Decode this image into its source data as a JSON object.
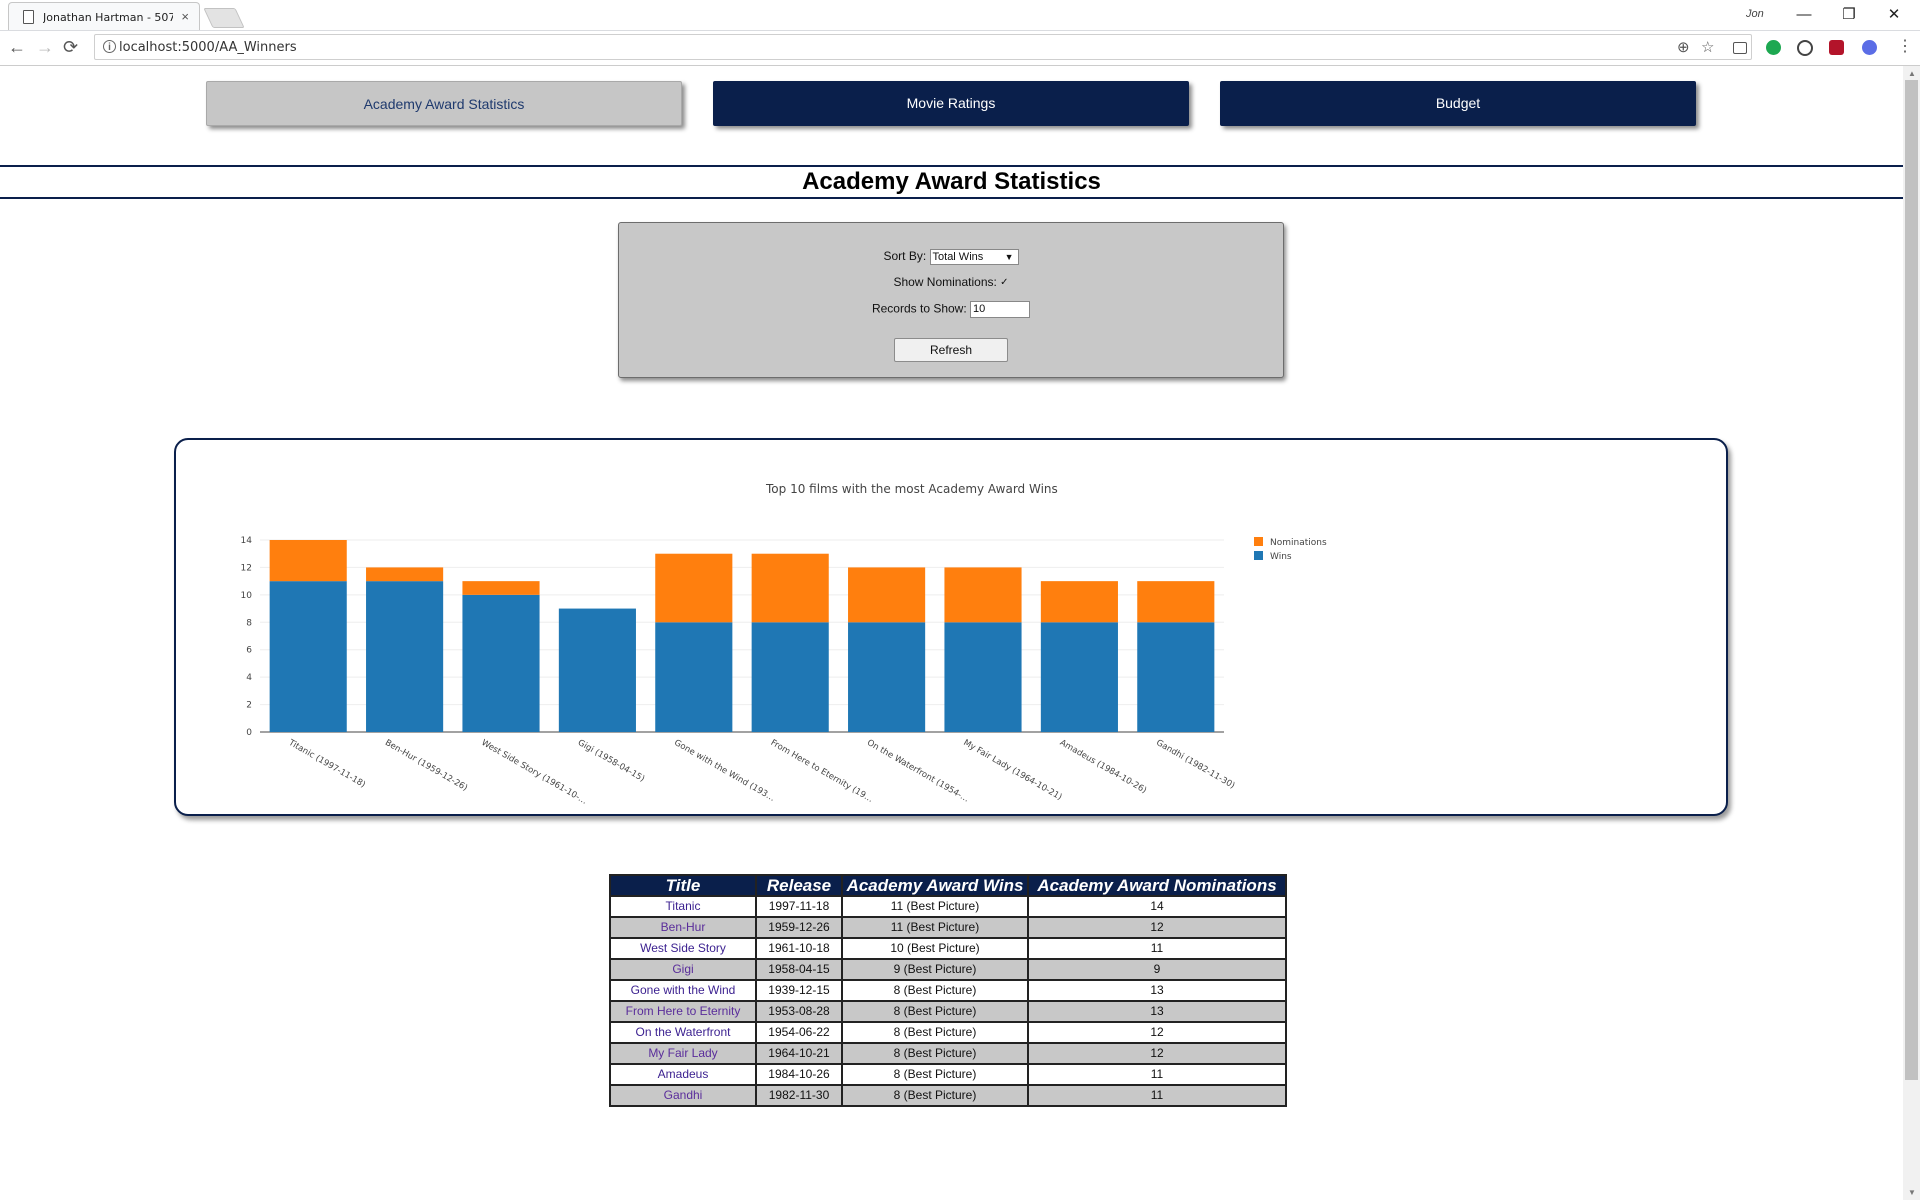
{
  "browser": {
    "tab_title": "Jonathan Hartman - 507",
    "tab_close": "×",
    "profile": "Jon",
    "url": "localhost:5000/AA_Winners",
    "back": "←",
    "forward": "→",
    "reload": "⟳",
    "minimize": "—",
    "restore": "❐",
    "close": "✕",
    "zoom": "⊕",
    "bookmark": "☆",
    "menu": "⋮"
  },
  "nav": {
    "items": [
      {
        "label": "Academy Award Statistics",
        "active": true
      },
      {
        "label": "Movie Ratings",
        "active": false
      },
      {
        "label": "Budget",
        "active": false
      }
    ]
  },
  "page": {
    "title": "Academy Award Statistics"
  },
  "controls": {
    "sort_label": "Sort By:",
    "sort_value": "Total Wins",
    "nominations_label": "Show Nominations:",
    "nominations_checked": "✓",
    "records_label": "Records to Show:",
    "records_value": "10",
    "refresh_label": "Refresh"
  },
  "chart_data": {
    "type": "bar",
    "stacked": true,
    "title": "Top 10 films with the most Academy Award Wins",
    "categories": [
      "Titanic (1997-11-18)",
      "Ben-Hur (1959-12-26)",
      "West Side Story (1961-10-18)",
      "Gigi (1958-04-15)",
      "Gone with the Wind (1939-12-15)",
      "From Here to Eternity (1953-08-28)",
      "On the Waterfront (1954-06-22)",
      "My Fair Lady (1964-10-21)",
      "Amadeus (1984-10-26)",
      "Gandhi (1982-11-30)"
    ],
    "categories_display": [
      "Titanic (1997-11-18)",
      "Ben-Hur (1959-12-26)",
      "West Side Story (1961-10-…",
      "Gigi (1958-04-15)",
      "Gone with the Wind (193…",
      "From Here to Eternity (19…",
      "On the Waterfront (1954-…",
      "My Fair Lady (1964-10-21)",
      "Amadeus (1984-10-26)",
      "Gandhi (1982-11-30)"
    ],
    "series": [
      {
        "name": "Wins",
        "color": "#1f77b4",
        "values": [
          11,
          11,
          10,
          9,
          8,
          8,
          8,
          8,
          8,
          8
        ]
      },
      {
        "name": "Nominations",
        "color": "#ff7f0e",
        "values": [
          14,
          12,
          11,
          9,
          13,
          13,
          12,
          12,
          11,
          11
        ]
      }
    ],
    "ylim": [
      0,
      14
    ],
    "yticks": [
      0,
      2,
      4,
      6,
      8,
      10,
      12,
      14
    ],
    "legend": "top-right",
    "legend_order": [
      "Nominations",
      "Wins"
    ],
    "grid": true
  },
  "table": {
    "headers": [
      "Title",
      "Release",
      "Academy Award Wins",
      "Academy Award Nominations"
    ],
    "rows": [
      [
        "Titanic",
        "1997-11-18",
        "11 (Best Picture)",
        "14"
      ],
      [
        "Ben-Hur",
        "1959-12-26",
        "11 (Best Picture)",
        "12"
      ],
      [
        "West Side Story",
        "1961-10-18",
        "10 (Best Picture)",
        "11"
      ],
      [
        "Gigi",
        "1958-04-15",
        "9 (Best Picture)",
        "9"
      ],
      [
        "Gone with the Wind",
        "1939-12-15",
        "8 (Best Picture)",
        "13"
      ],
      [
        "From Here to Eternity",
        "1953-08-28",
        "8 (Best Picture)",
        "13"
      ],
      [
        "On the Waterfront",
        "1954-06-22",
        "8 (Best Picture)",
        "12"
      ],
      [
        "My Fair Lady",
        "1964-10-21",
        "8 (Best Picture)",
        "12"
      ],
      [
        "Amadeus",
        "1984-10-26",
        "8 (Best Picture)",
        "11"
      ],
      [
        "Gandhi",
        "1982-11-30",
        "8 (Best Picture)",
        "11"
      ]
    ]
  }
}
